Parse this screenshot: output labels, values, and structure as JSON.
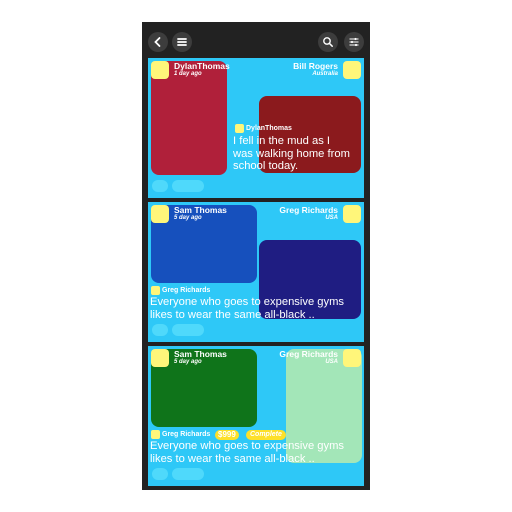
{
  "icons": {
    "back": "chevron-left-icon",
    "menu": "hamburger-menu-icon",
    "search": "search-icon",
    "filter": "sliders-icon"
  },
  "cards": [
    {
      "left_name": "DylanThomas",
      "left_time": "1 day ago",
      "right_name": "Bill Rogers",
      "right_location": "Australia",
      "author": "DylanThomas",
      "message": "I fell in the mud as I was walking home from school today.",
      "left_color": "#b0203a",
      "right_color": "#8b1a1d"
    },
    {
      "left_name": "Sam Thomas",
      "left_time": "5 day ago",
      "right_name": "Greg Richards",
      "right_location": "USA",
      "author": "Greg Richards",
      "message": "Everyone who goes to expensive gyms likes to wear the same all-black ..",
      "left_color": "#1650bd",
      "right_color": "#1f1d82"
    },
    {
      "left_name": "Sam Thomas",
      "left_time": "5 day ago",
      "right_name": "Greg Richards",
      "right_location": "USA",
      "author": "Greg Richards",
      "price": "$999",
      "status": "Complete",
      "message": "Everyone who goes to expensive gyms likes to wear the same all-black ..",
      "left_color": "#0f741a",
      "right_color": "#a3e6b8"
    }
  ]
}
